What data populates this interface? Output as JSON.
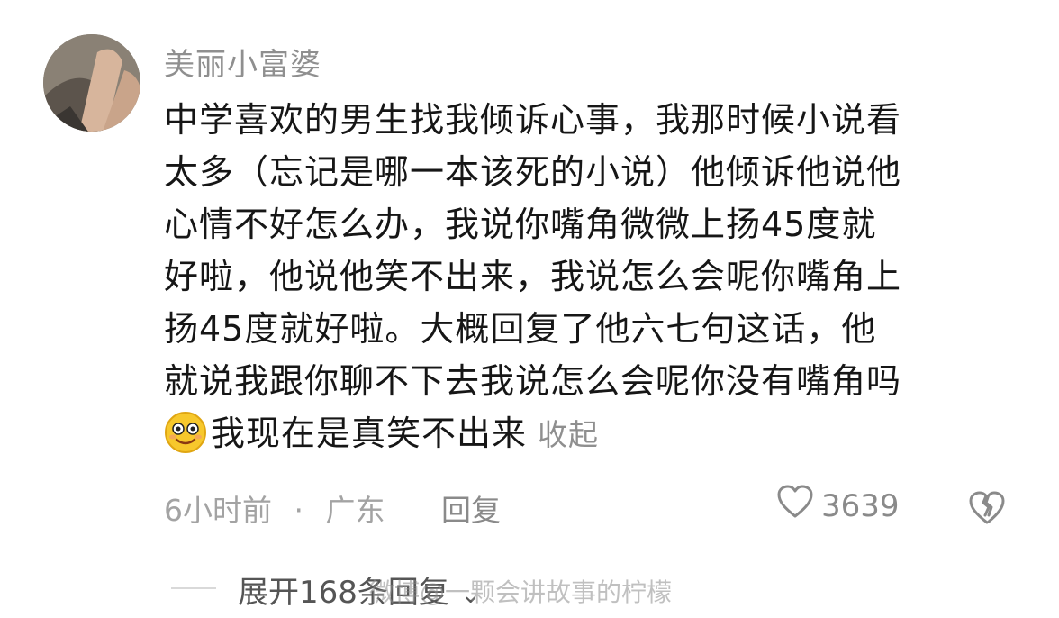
{
  "comment": {
    "username": "美丽小富婆",
    "lines": [
      "中学喜欢的男生找我倾诉心事，我那时候小说看",
      "太多（忘记是哪一本该死的小说）他倾诉他说他",
      "心情不好怎么办，我说你嘴角微微上扬45度就",
      "好啦，他说他笑不出来，我说怎么会呢你嘴角上",
      "扬45度就好啦。大概回复了他六七句这话，他",
      "就说我跟你聊不下去我说怎么会呢你没有嘴角吗",
      "我现在是真笑不出来"
    ],
    "emoji_icon": "smiley-emoji",
    "collapse_label": "收起",
    "time": "6小时前",
    "separator": "·",
    "location": "广东",
    "reply_label": "回复",
    "like_count": "3639",
    "like_icon": "heart-outline-icon",
    "dislike_icon": "broken-heart-icon"
  },
  "replies": {
    "expand_label": "展开168条回复"
  },
  "watermark": "微博@一颗会讲故事的柠檬"
}
